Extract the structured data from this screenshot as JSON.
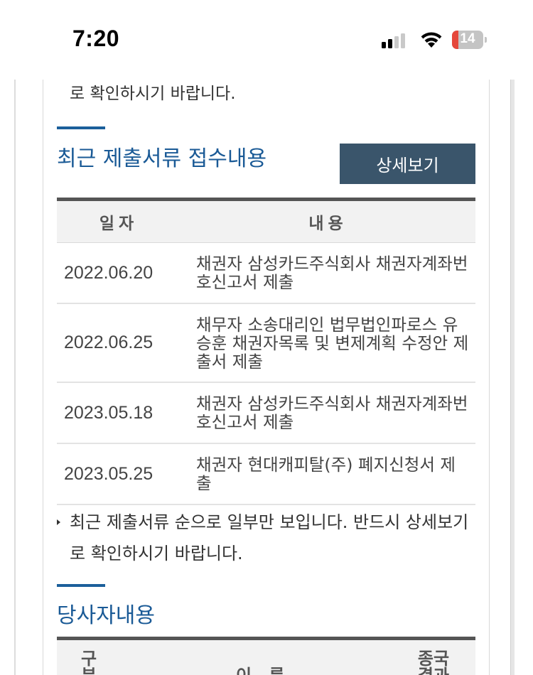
{
  "status_bar": {
    "time": "7:20",
    "battery_level": "14",
    "battery_color": "#e5473b",
    "icons": [
      "cellular-signal-icon",
      "wifi-icon",
      "battery-icon"
    ]
  },
  "page": {
    "top_note": "로 확인하시기 바랍니다.",
    "accent_color": "#1b5f9b",
    "recent_docs": {
      "title": "최근 제출서류 접수내용",
      "detail_button": "상세보기",
      "columns": [
        "일자",
        "내용"
      ],
      "rows": [
        {
          "date": "2022.06.20",
          "content": "채권자 삼성카드주식회사 채권자계좌번호신고서 제출"
        },
        {
          "date": "2022.06.25",
          "content": "채무자 소송대리인 법무법인파로스 유승훈 채권자목록 및 변제계획 수정안 제출서 제출"
        },
        {
          "date": "2023.05.18",
          "content": "채권자 삼성카드주식회사 채권자계좌번호신고서 제출"
        },
        {
          "date": "2023.05.25",
          "content": "채권자 현대캐피탈(주) 폐지신청서 제출"
        }
      ],
      "footnote": "최근 제출서류 순으로 일부만 보입니다. 반드시 상세보기로 확인하시기 바랍니다."
    },
    "parties": {
      "title": "당사자내용",
      "columns": [
        "구분",
        "이 름",
        "종국결과"
      ]
    }
  }
}
